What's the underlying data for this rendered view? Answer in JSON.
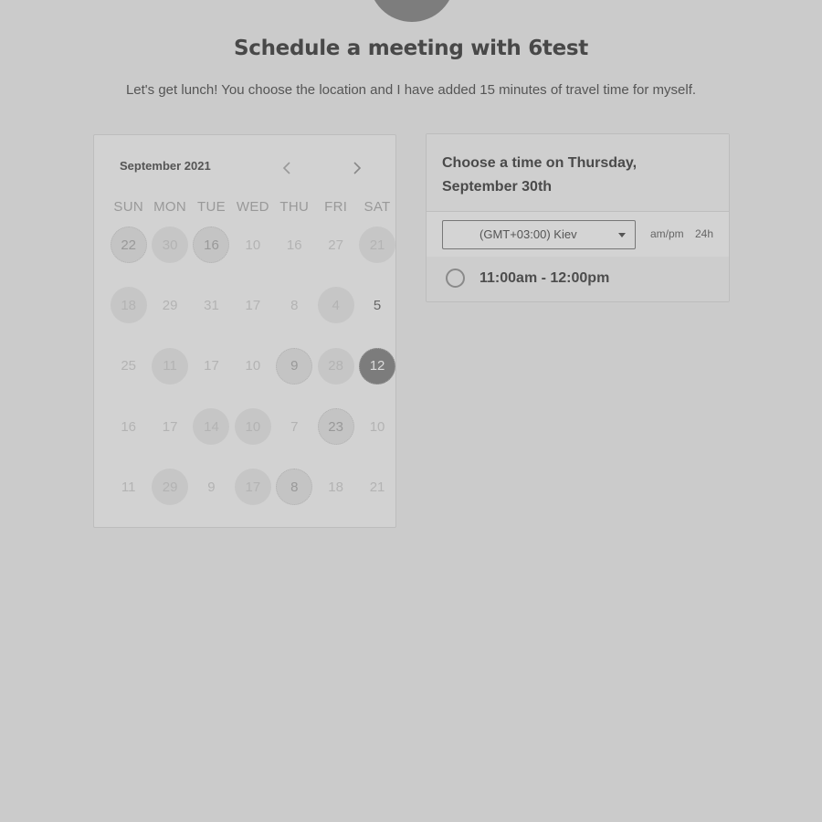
{
  "header": {
    "title": "Schedule a meeting with 6test",
    "subtitle": "Let's get lunch! You choose the location and I have added 15 minutes of travel time for myself."
  },
  "calendar": {
    "month_label": "September 2021",
    "prev_icon": "chevron-left-icon",
    "next_icon": "chevron-right-icon",
    "weekdays": [
      "SUN",
      "MON",
      "TUE",
      "WED",
      "THU",
      "FRI",
      "SAT"
    ],
    "weeks": [
      [
        "22",
        "30",
        "16",
        "10",
        "16",
        "27",
        "21"
      ],
      [
        "18",
        "29",
        "31",
        "17",
        "8",
        "4",
        "5"
      ],
      [
        "25",
        "11",
        "17",
        "10",
        "9",
        "28",
        "12"
      ],
      [
        "16",
        "17",
        "14",
        "10",
        "7",
        "23",
        "10"
      ],
      [
        "11",
        "29",
        "9",
        "17",
        "8",
        "18",
        "21"
      ]
    ],
    "selected_day": "12"
  },
  "time_panel": {
    "title": "Choose a time on Thursday, September 30th",
    "timezone": "(GMT+03:00) Kiev",
    "format_ampm": "am/pm",
    "format_24h": "24h",
    "slots": [
      {
        "label": "11:00am - 12:00pm"
      }
    ]
  },
  "colors": {
    "page_background": "#cbcbcb",
    "selected_day": "#7c7c7c"
  }
}
